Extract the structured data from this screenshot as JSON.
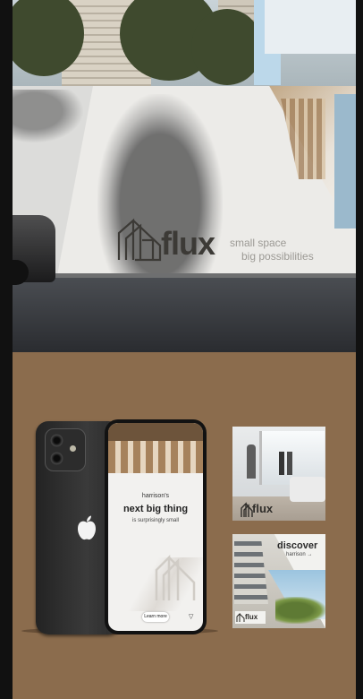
{
  "billboard": {
    "brand": "flux",
    "tagline_line1": "small space",
    "tagline_line2": "big possibilities"
  },
  "phone_screen": {
    "kicker": "harrison's",
    "headline": "next big thing",
    "subline": "is surprisingly small",
    "button_label": "Learn more",
    "corner_glyph": "▽"
  },
  "card_interior": {
    "brand": "flux"
  },
  "card_exterior": {
    "headline": "discover",
    "subline": "harrison →",
    "brand": "flux"
  },
  "colors": {
    "backdrop_brown": "#8b6c4d",
    "wall_white": "#ecebe8",
    "logo_dark": "#3c3a36",
    "tagline_grey": "#9c9a95"
  }
}
